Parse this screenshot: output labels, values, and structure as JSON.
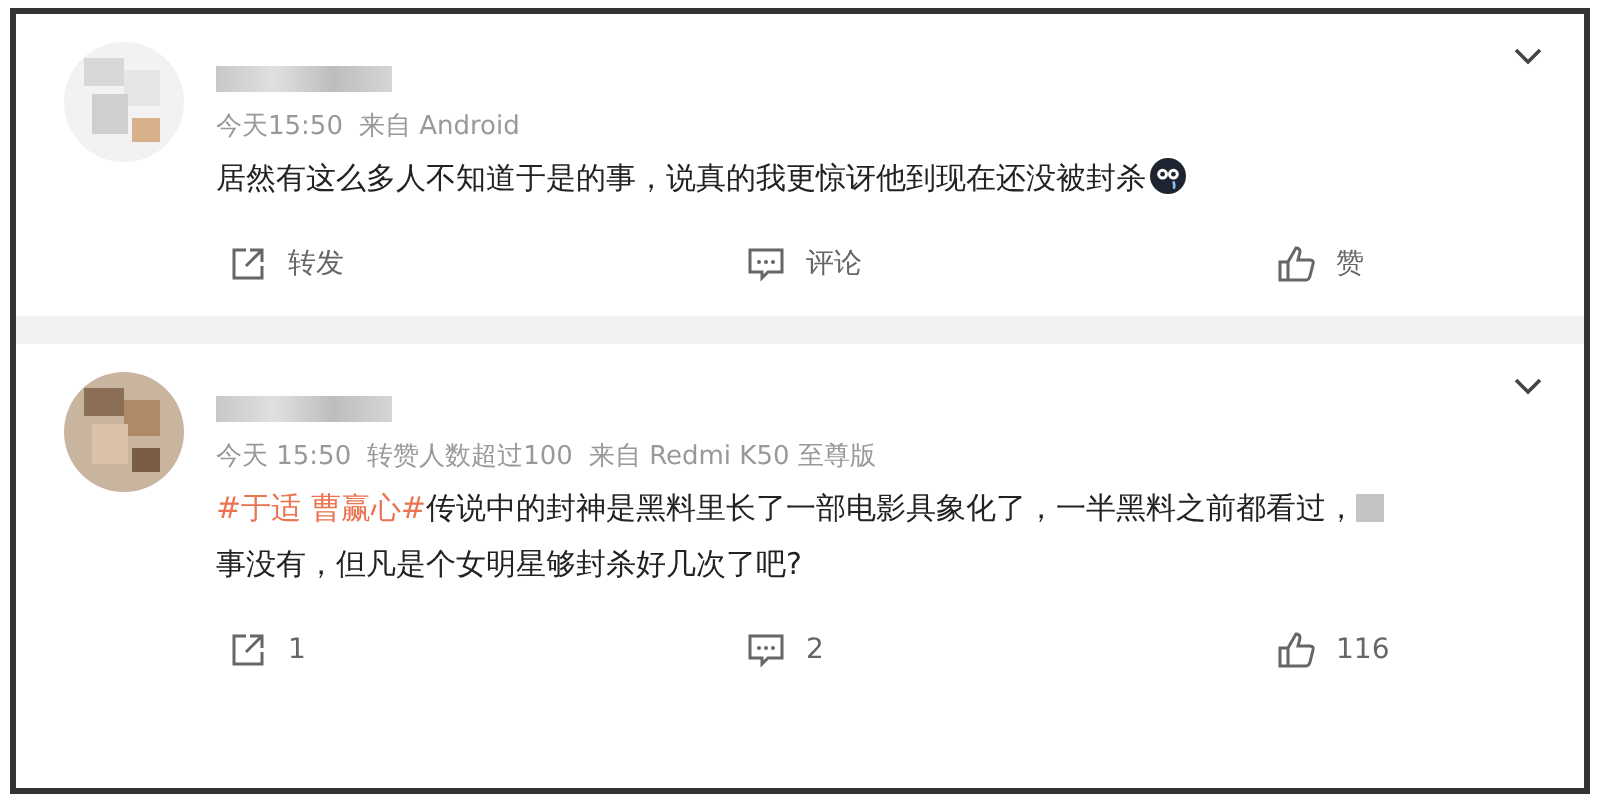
{
  "comments": [
    {
      "time": "今天15:50",
      "source": "来自 Android",
      "text": "居然有这么多人不知道于是的事，说真的我更惊讶他到现在还没被封杀",
      "emoji": {
        "kind": "dark"
      },
      "actions": [
        {
          "kind": "repost",
          "label": "转发"
        },
        {
          "kind": "comment",
          "label": "评论"
        },
        {
          "kind": "like",
          "label": "赞"
        }
      ]
    },
    {
      "time": "今天 15:50",
      "meta": [
        "转赞人数超过100"
      ],
      "source": "来自 Redmi K50 至尊版",
      "hashtag": "#于适 曹赢心#",
      "text": "传说中的封神是黑料里长了一部电影具象化了，一半黑料之前都看过，",
      "emoji": {
        "kind": "blurred"
      },
      "text2": "事没有，但凡是个女明星够封杀好几次了吧?",
      "actions": [
        {
          "kind": "repost",
          "label": "1"
        },
        {
          "kind": "comment",
          "label": "2"
        },
        {
          "kind": "like",
          "label": "116"
        }
      ]
    }
  ]
}
